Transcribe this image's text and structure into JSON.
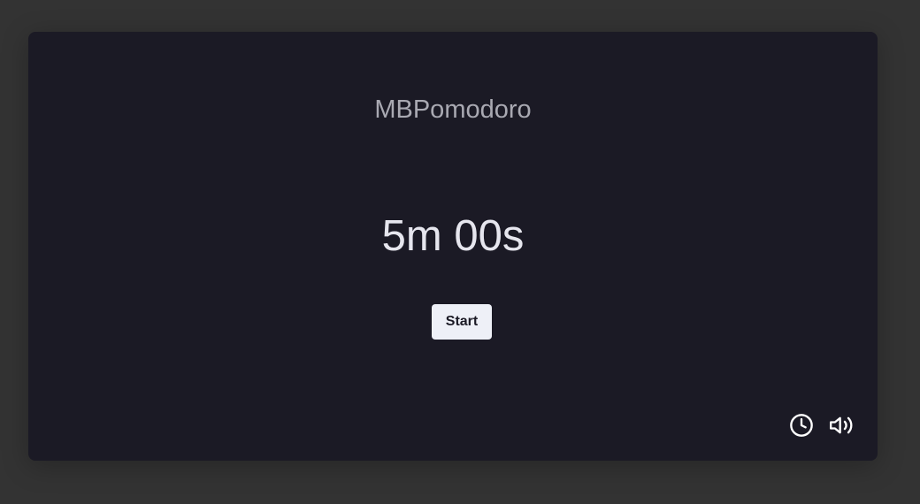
{
  "app": {
    "title": "MBPomodoro"
  },
  "timer": {
    "display": "5m 00s"
  },
  "controls": {
    "start_label": "Start"
  },
  "toolbar": {
    "icons": [
      "clock-icon",
      "volume-icon"
    ]
  },
  "colors": {
    "page_background": "#333333",
    "card_background": "#1b1a25",
    "title_text": "#a9a9b2",
    "timer_text": "#e6e6ee",
    "button_background": "#eef0f7"
  }
}
